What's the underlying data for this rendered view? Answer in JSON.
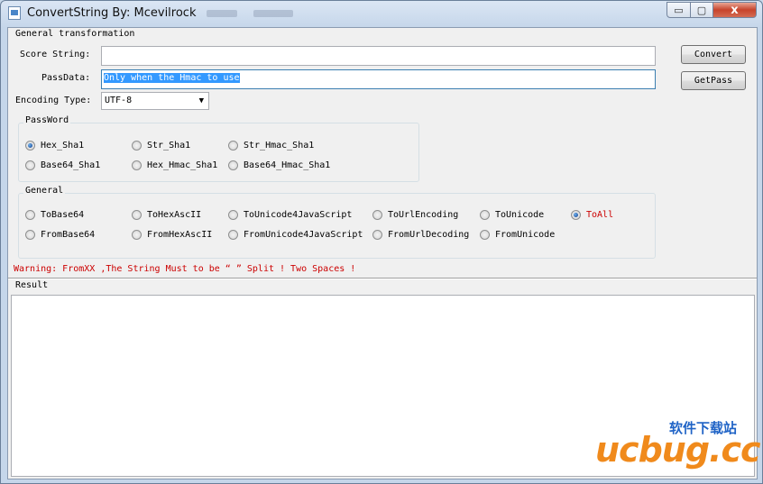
{
  "window": {
    "title": "ConvertString By: Mcevilrock"
  },
  "titlebar": {
    "minimize": "▭",
    "maximize": "▢",
    "close": "x"
  },
  "section": {
    "general_transformation": "General transformation",
    "result": "Result"
  },
  "form": {
    "score_label": "Score String:",
    "score_value": "",
    "passdata_label": "PassData:",
    "passdata_value": "Only when the Hmac to use",
    "encoding_label": "Encoding Type:",
    "encoding_value": "UTF-8"
  },
  "buttons": {
    "convert": "Convert",
    "getpass": "GetPass"
  },
  "password_group": {
    "label": "PassWord",
    "options": [
      "Hex_Sha1",
      "Str_Sha1",
      "Str_Hmac_Sha1",
      "Base64_Sha1",
      "Hex_Hmac_Sha1",
      "Base64_Hmac_Sha1"
    ],
    "selected": "Hex_Sha1"
  },
  "general_group": {
    "label": "General",
    "options": [
      "ToBase64",
      "ToHexAscII",
      "ToUnicode4JavaScript",
      "ToUrlEncoding",
      "ToUnicode",
      "ToAll",
      "FromBase64",
      "FromHexAscII",
      "FromUnicode4JavaScript",
      "FromUrlDecoding",
      "FromUnicode"
    ],
    "selected": "ToAll"
  },
  "warning": "Warning:  FromXX ,The String Must to be “  ” Split ! Two Spaces !",
  "result_text": "",
  "watermark": {
    "brand": "ucbug.cc",
    "chinese": "软件下载站"
  },
  "colors": {
    "accent_red": "#cc0000",
    "selection_blue": "#3399ff",
    "watermark_orange": "#f08a1c",
    "watermark_blue": "#1f63c6"
  }
}
